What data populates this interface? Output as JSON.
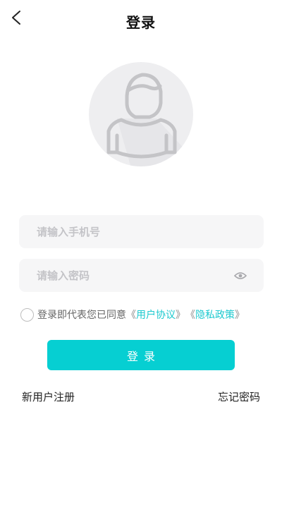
{
  "header": {
    "title": "登录"
  },
  "form": {
    "phone_placeholder": "请输入手机号",
    "password_placeholder": "请输入密码"
  },
  "agreement": {
    "text": "登录即代表您已同意",
    "bracket_open": "《",
    "bracket_close": "》",
    "user_agreement": "用户协议",
    "privacy_policy": "隐私政策"
  },
  "login_button": {
    "label": "登录"
  },
  "links": {
    "register": "新用户注册",
    "forgot": "忘记密码"
  },
  "colors": {
    "accent": "#06cfd2",
    "link": "#1cc9cf",
    "input_bg": "#f6f6f7",
    "placeholder": "#c4c4c8"
  },
  "icons": {
    "back": "chevron-left-icon",
    "avatar": "user-avatar-icon",
    "eye": "eye-icon",
    "checkbox": "radio-circle-icon"
  }
}
